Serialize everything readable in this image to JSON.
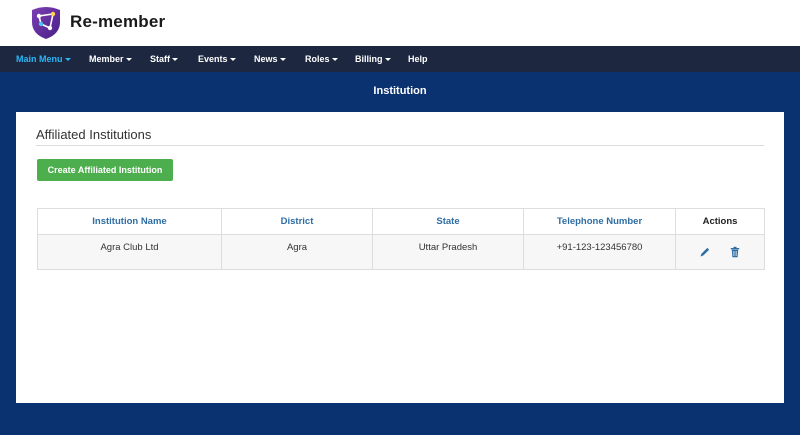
{
  "app": {
    "name": "Re-member"
  },
  "nav": {
    "items": [
      {
        "label": "Main Menu",
        "dropdown": true,
        "active": true
      },
      {
        "label": "Member",
        "dropdown": true
      },
      {
        "label": "Staff",
        "dropdown": true
      },
      {
        "label": "Events",
        "dropdown": true
      },
      {
        "label": "News",
        "dropdown": true
      },
      {
        "label": "Roles",
        "dropdown": true
      },
      {
        "label": "Billing",
        "dropdown": true
      },
      {
        "label": "Help",
        "dropdown": false
      }
    ]
  },
  "page": {
    "title": "Institution"
  },
  "panel": {
    "heading": "Affiliated Institutions",
    "create_button": "Create Affiliated Institution"
  },
  "table": {
    "columns": [
      "Institution Name",
      "District",
      "State",
      "Telephone Number",
      "Actions"
    ],
    "rows": [
      {
        "name": "Agra Club Ltd",
        "district": "Agra",
        "state": "Uttar Pradesh",
        "phone": "+91-123-123456780"
      }
    ],
    "row_actions": [
      "edit-icon",
      "trash-icon"
    ]
  },
  "colors": {
    "background": "#0b3270",
    "navbar": "#1d2840",
    "nav_active": "#29b6f6",
    "header_text": "#2e6da4",
    "create_button": "#4cae4c",
    "icon": "#2e6da4"
  }
}
